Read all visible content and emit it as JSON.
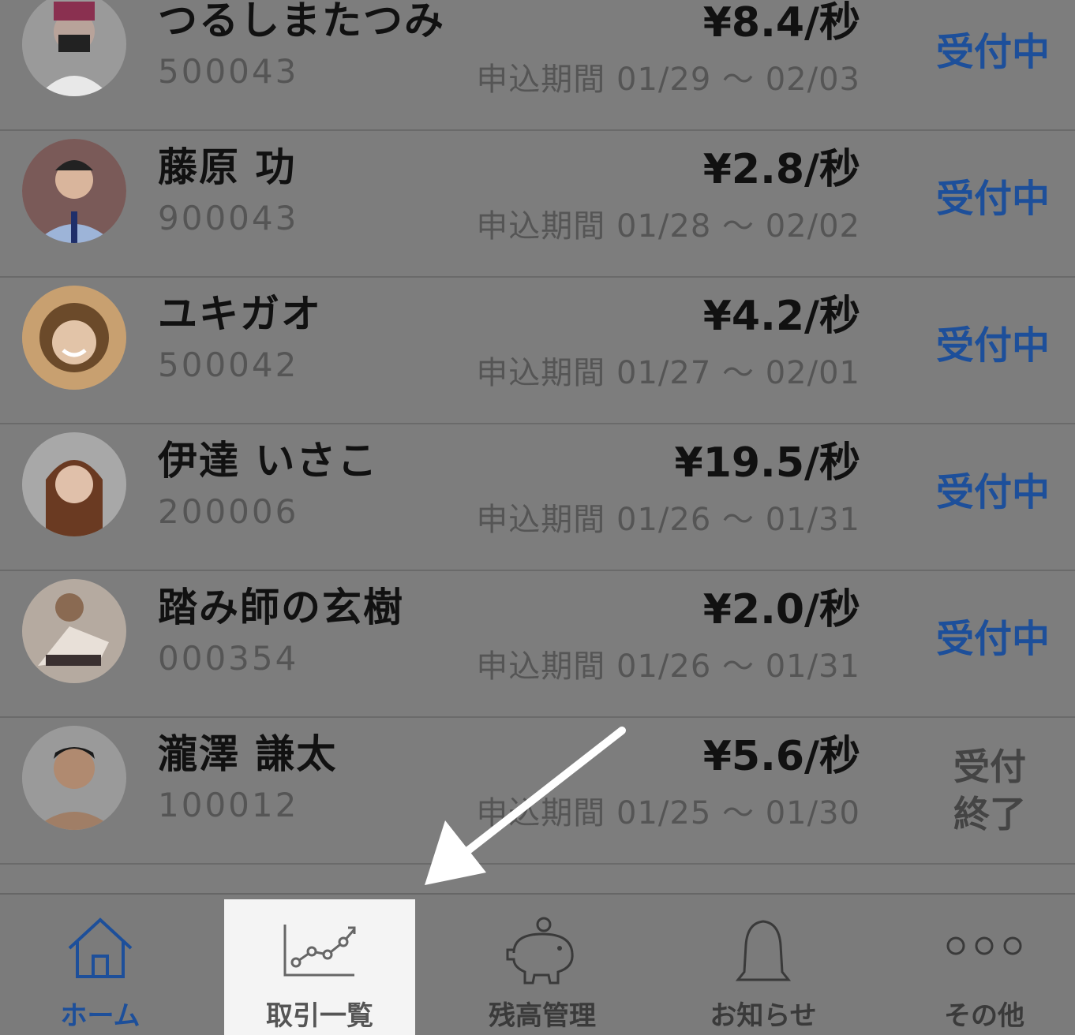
{
  "rows": [
    {
      "name": "つるしまたつみ",
      "code": "500043",
      "rate": "¥8.4/秒",
      "period": "申込期間 01/29 ～ 02/03",
      "status": "受付中",
      "status_closed": false
    },
    {
      "name": "藤原 功",
      "code": "900043",
      "rate": "¥2.8/秒",
      "period": "申込期間 01/28 ～ 02/02",
      "status": "受付中",
      "status_closed": false
    },
    {
      "name": "ユキガオ",
      "code": "500042",
      "rate": "¥4.2/秒",
      "period": "申込期間 01/27 ～ 02/01",
      "status": "受付中",
      "status_closed": false
    },
    {
      "name": "伊達 いさこ",
      "code": "200006",
      "rate": "¥19.5/秒",
      "period": "申込期間 01/26 ～ 01/31",
      "status": "受付中",
      "status_closed": false
    },
    {
      "name": "踏み師の玄樹",
      "code": "000354",
      "rate": "¥2.0/秒",
      "period": "申込期間 01/26 ～ 01/31",
      "status": "受付中",
      "status_closed": false
    },
    {
      "name": "瀧澤 謙太",
      "code": "100012",
      "rate": "¥5.6/秒",
      "period": "申込期間 01/25 ～ 01/30",
      "status": "受付終了",
      "status_closed": true
    }
  ],
  "tabs": {
    "home": "ホーム",
    "trades": "取引一覧",
    "balance": "残高管理",
    "notices": "お知らせ",
    "other": "その他"
  },
  "colors": {
    "accent": "#1d4f9a",
    "overlay": "#7d7d7d",
    "highlight": "#f4f4f4"
  }
}
